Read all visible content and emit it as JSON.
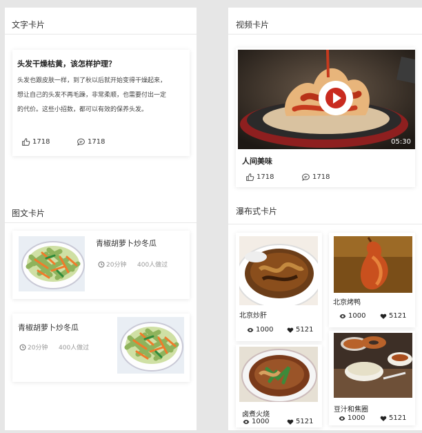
{
  "text_card": {
    "section_title": "文字卡片",
    "heading": "头发干燥枯黄，该怎样护理？",
    "body_lines": [
      "头发也跟皮肤一样，到了秋以后就开始变得干燥起来，",
      "想让自己的头发不再毛躁，非常柔顺，也需要付出一定",
      "的代价。这些小招数，都可以有效的保养头发。"
    ],
    "likes": "1718",
    "comments": "1718"
  },
  "image_text_card": {
    "section_title": "图文卡片",
    "items": [
      {
        "title": "青椒胡萝卜炒冬瓜",
        "time": "20分钟",
        "made": "400人做过"
      },
      {
        "title": "青椒胡萝卜炒冬瓜",
        "time": "20分钟",
        "made": "400人做过"
      }
    ]
  },
  "video_card": {
    "section_title": "视频卡片",
    "duration": "05:30",
    "title": "人间美味",
    "likes": "1718",
    "comments": "1718"
  },
  "waterfall_card": {
    "section_title": "瀑布式卡片",
    "items": [
      {
        "name": "北京炒肝",
        "views": "1000",
        "likes": "5121"
      },
      {
        "name": "北京烤鸭",
        "views": "1000",
        "likes": "5121"
      },
      {
        "name": "卤煮火烧",
        "views": "1000",
        "likes": "5121"
      },
      {
        "name": "豆汁和焦圈",
        "views": "1000",
        "likes": "5121"
      }
    ]
  },
  "colors": {
    "page_bg": "#e6e6e6",
    "card_bg": "#ffffff",
    "divider": "#e8e8e8",
    "meta_text": "#999999"
  }
}
